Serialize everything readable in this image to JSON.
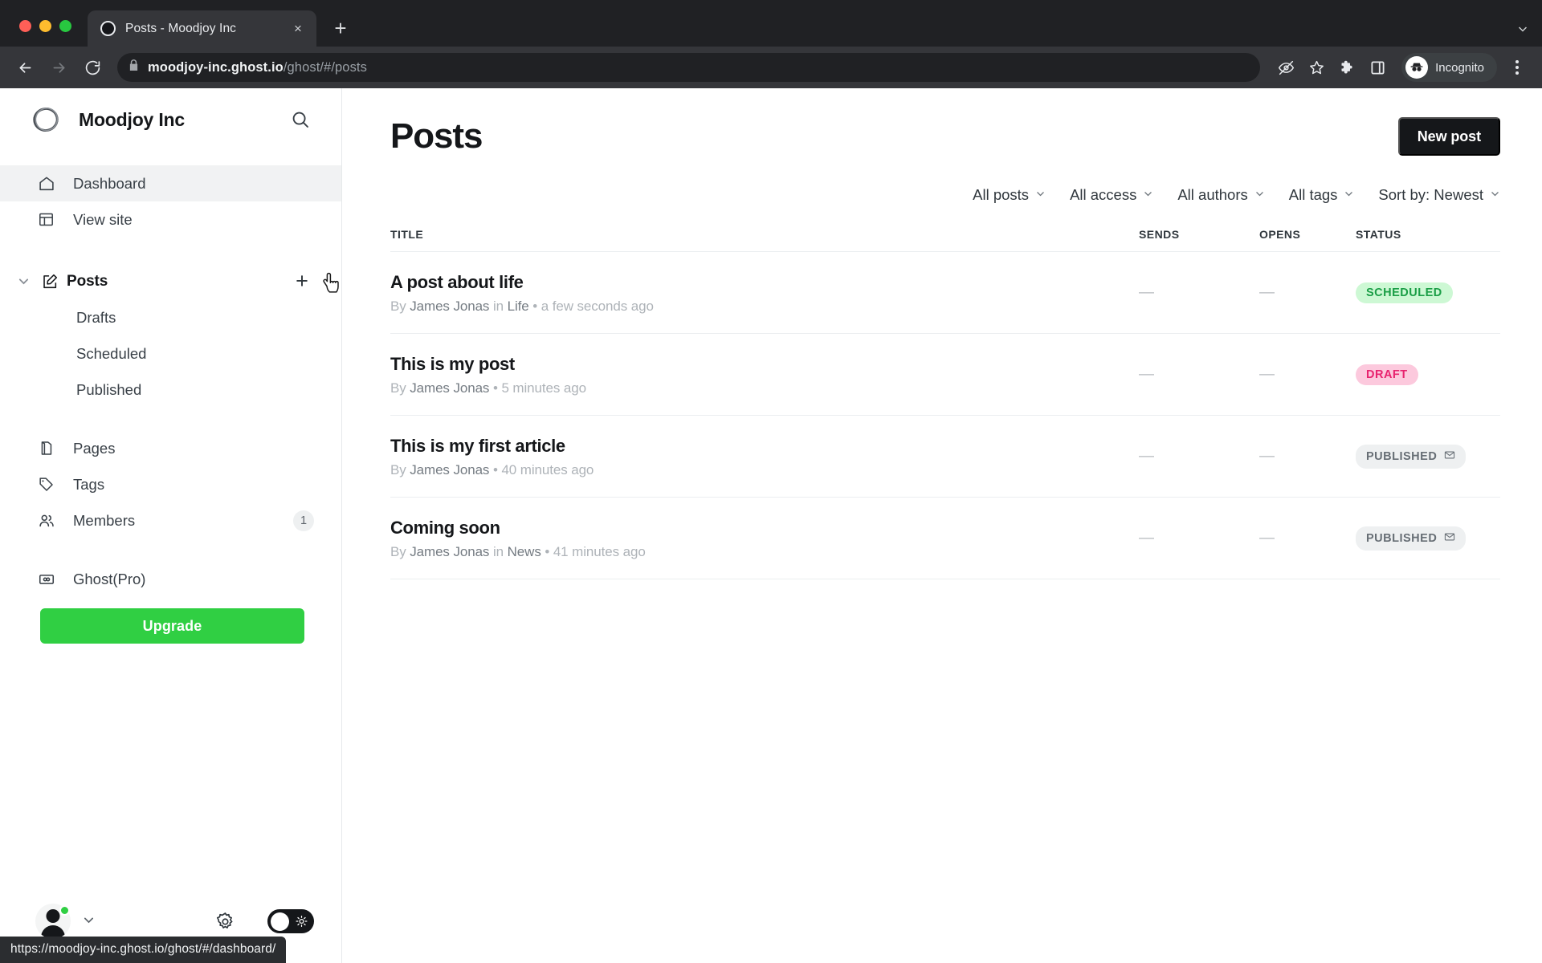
{
  "browser": {
    "tab": {
      "title": "Posts - Moodjoy Inc",
      "favicon": "ghost-ring-icon",
      "close_label": "×"
    },
    "new_tab_label": "+",
    "address": {
      "url_bold": "moodjoy-inc.ghost.io",
      "url_rest": "/ghost/#/posts"
    },
    "profile_label": "Incognito",
    "toolbar_icons": [
      "back-arrow-icon",
      "forward-arrow-icon",
      "reload-icon",
      "lock-icon",
      "eye-off-icon",
      "bookmark-star-icon",
      "extensions-puzzle-icon",
      "side-panel-icon",
      "incognito-avatar-icon",
      "kebab-menu-icon"
    ]
  },
  "status_bar": {
    "url": "https://moodjoy-inc.ghost.io/ghost/#/dashboard/"
  },
  "sidebar": {
    "brand": {
      "name": "Moodjoy Inc",
      "logo": "ghost-ring-logo"
    },
    "search_icon": "search-icon",
    "primary": [
      {
        "label": "Dashboard",
        "icon": "home-icon",
        "active": true
      },
      {
        "label": "View site",
        "icon": "layout-icon",
        "active": false
      }
    ],
    "posts_group": {
      "label": "Posts",
      "icon": "pencil-square-icon",
      "chevron": "chevron-down-icon",
      "add_label": "+",
      "children": [
        {
          "label": "Drafts"
        },
        {
          "label": "Scheduled"
        },
        {
          "label": "Published"
        }
      ]
    },
    "secondary": [
      {
        "label": "Pages",
        "icon": "book-icon",
        "badge": ""
      },
      {
        "label": "Tags",
        "icon": "tag-icon",
        "badge": ""
      },
      {
        "label": "Members",
        "icon": "members-icon",
        "badge": "1"
      }
    ],
    "tertiary": [
      {
        "label": "Ghost(Pro)",
        "icon": "ghost-pro-icon",
        "badge": ""
      }
    ],
    "upgrade_label": "Upgrade",
    "footer": {
      "avatar": "user-avatar",
      "presence": "online",
      "chevron": "chevron-down-icon",
      "gear_icon": "gear-icon",
      "theme_toggle": {
        "state": "light",
        "sun_icon": "sun-icon"
      }
    }
  },
  "main": {
    "title": "Posts",
    "new_post_label": "New post",
    "filters": [
      {
        "label": "All posts",
        "caret": "⌄"
      },
      {
        "label": "All access",
        "caret": "⌄"
      },
      {
        "label": "All authors",
        "caret": "⌄"
      },
      {
        "label": "All tags",
        "caret": "⌄"
      },
      {
        "label": "Sort by: Newest",
        "caret": "⌄"
      }
    ],
    "columns": {
      "title": "TITLE",
      "sends": "SENDS",
      "opens": "OPENS",
      "status": "STATUS"
    },
    "posts": [
      {
        "title": "A post about life",
        "by": "By ",
        "author": "James Jonas",
        "in": " in ",
        "tag": "Life",
        "sep": " • ",
        "time": "a few seconds ago",
        "sends": "—",
        "opens": "—",
        "status": "SCHEDULED",
        "status_class": "scheduled",
        "has_mail_icon": false
      },
      {
        "title": "This is my post",
        "by": "By ",
        "author": "James Jonas",
        "in": "",
        "tag": "",
        "sep": " • ",
        "time": "5 minutes ago",
        "sends": "—",
        "opens": "—",
        "status": "DRAFT",
        "status_class": "draft",
        "has_mail_icon": false
      },
      {
        "title": "This is my first article",
        "by": "By ",
        "author": "James Jonas",
        "in": "",
        "tag": "",
        "sep": " • ",
        "time": "40 minutes ago",
        "sends": "—",
        "opens": "—",
        "status": "PUBLISHED",
        "status_class": "published",
        "has_mail_icon": true
      },
      {
        "title": "Coming soon",
        "by": "By ",
        "author": "James Jonas",
        "in": " in ",
        "tag": "News",
        "sep": " • ",
        "time": "41 minutes ago",
        "sends": "—",
        "opens": "—",
        "status": "PUBLISHED",
        "status_class": "published",
        "has_mail_icon": true
      }
    ]
  },
  "colors": {
    "accent_green": "#30cf43",
    "scheduled_bg": "#cdf8d4",
    "scheduled_fg": "#1a9e46",
    "draft_bg": "#fcc9dd",
    "draft_fg": "#e8236f",
    "published_bg": "#eef0f1",
    "published_fg": "#676e75",
    "dark": "#15171a"
  }
}
